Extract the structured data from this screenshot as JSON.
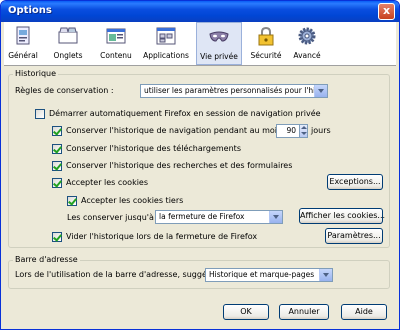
{
  "window": {
    "title": "Options",
    "close_glyph": "x"
  },
  "toolbar": {
    "tabs": [
      {
        "label": "Général",
        "icon": "general-icon"
      },
      {
        "label": "Onglets",
        "icon": "tabs-icon"
      },
      {
        "label": "Contenu",
        "icon": "content-icon"
      },
      {
        "label": "Applications",
        "icon": "applications-icon"
      },
      {
        "label": "Vie privée",
        "icon": "privacy-mask-icon",
        "selected": true
      },
      {
        "label": "Sécurité",
        "icon": "lock-icon"
      },
      {
        "label": "Avancé",
        "icon": "gear-icon"
      }
    ]
  },
  "history": {
    "group_label": "Historique",
    "rules_label": "Règles de conservation :",
    "rules_value": "utiliser les paramètres personnalisés pour l'historique",
    "autostart_label": "Démarrer automatiquement Firefox en session de navigation privée",
    "autostart_checked": false,
    "keep_browsing_label": "Conserver l'historique de navigation pendant au moins",
    "keep_browsing_checked": true,
    "keep_days": "90",
    "days_label": "jours",
    "keep_downloads_label": "Conserver l'historique des téléchargements",
    "keep_downloads_checked": true,
    "keep_forms_label": "Conserver l'historique des recherches et des formulaires",
    "keep_forms_checked": true,
    "accept_cookies_label": "Accepter les cookies",
    "accept_cookies_checked": true,
    "exceptions_button": "Exceptions...",
    "third_party_label": "Accepter les cookies tiers",
    "third_party_checked": true,
    "keep_until_label": "Les conserver jusqu'à :",
    "keep_until_value": "la fermeture de Firefox",
    "show_cookies_button": "Afficher les cookies...",
    "clear_on_close_label": "Vider l'historique lors de la fermeture de Firefox",
    "clear_on_close_checked": true,
    "settings_button": "Paramètres..."
  },
  "addressbar": {
    "group_label": "Barre d'adresse",
    "suggest_label": "Lors de l'utilisation de la barre d'adresse, suggérer :",
    "suggest_value": "Historique et marque-pages"
  },
  "footer": {
    "ok": "OK",
    "cancel": "Annuler",
    "help": "Aide"
  }
}
